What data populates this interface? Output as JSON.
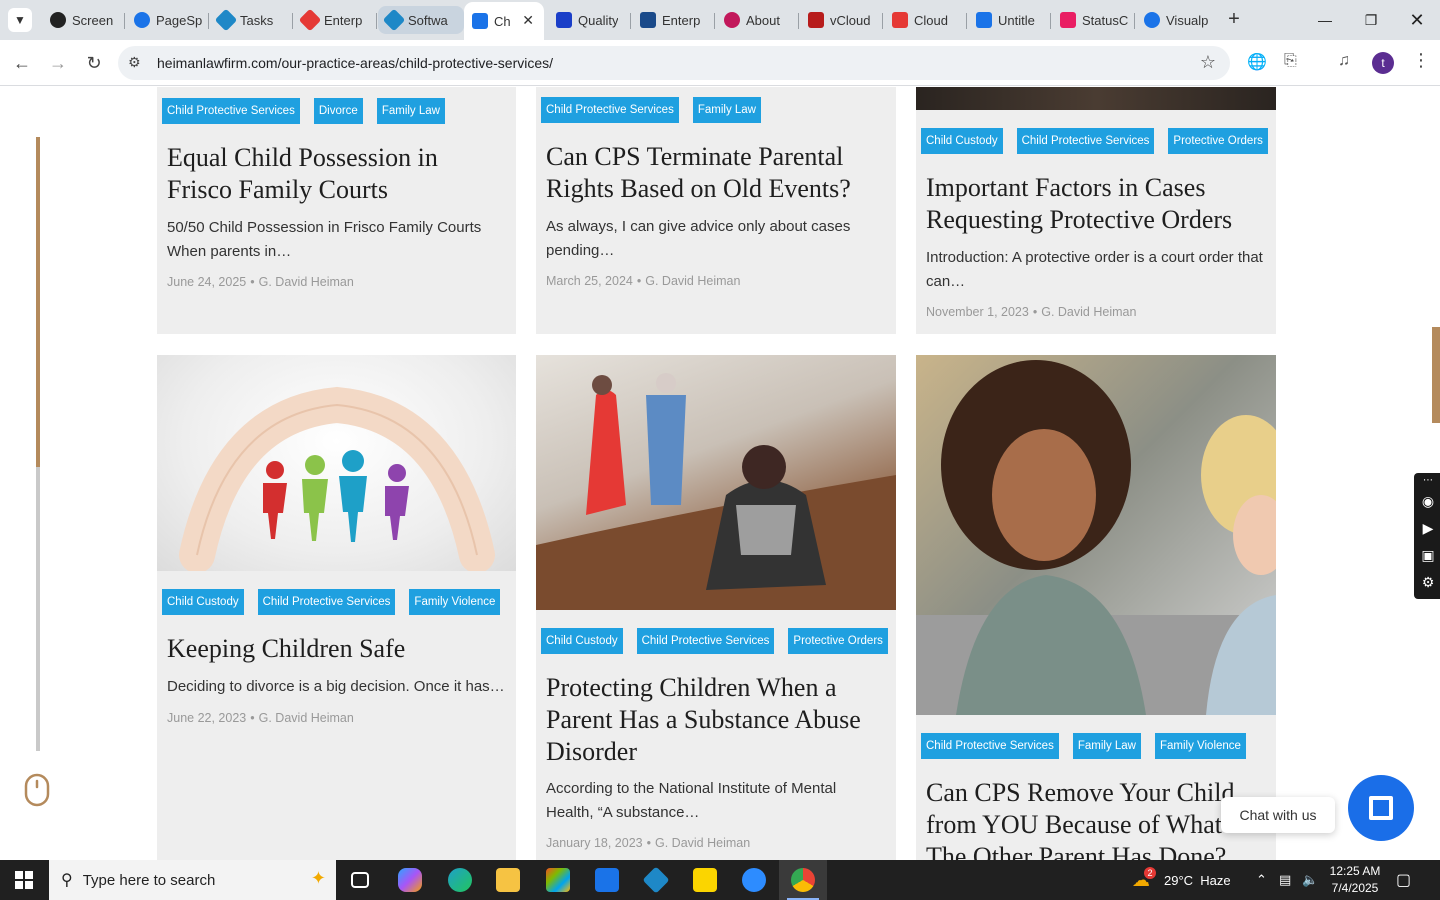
{
  "browser": {
    "tabs": [
      {
        "title": "Screen",
        "color": "#222222",
        "active": false
      },
      {
        "title": "PageSp",
        "color": "#1a73e8",
        "active": false
      },
      {
        "title": "Tasks",
        "color": "#1e88c7",
        "active": false
      },
      {
        "title": "Enterp",
        "color": "#e53935",
        "active": false
      },
      {
        "title": "Softwa",
        "color": "#1e88c7",
        "active": false
      },
      {
        "title": "Ch",
        "color": "#1a73e8",
        "active": true
      },
      {
        "title": "Quality",
        "color": "#1a3ec8",
        "active": false
      },
      {
        "title": "Enterp",
        "color": "#1a4a8a",
        "active": false
      },
      {
        "title": "About",
        "color": "#c2185b",
        "active": false
      },
      {
        "title": "vCloud",
        "color": "#b71c1c",
        "active": false
      },
      {
        "title": "Cloud",
        "color": "#e53935",
        "active": false
      },
      {
        "title": "Untitle",
        "color": "#1a73e8",
        "active": false
      },
      {
        "title": "StatusC",
        "color": "#e91e63",
        "active": false
      },
      {
        "title": "Visualp",
        "color": "#1a73e8",
        "active": false
      }
    ],
    "url": "heimanlawfirm.com/our-practice-areas/child-protective-services/",
    "profile_initial": "t"
  },
  "posts": [
    {
      "tags": [
        "Child Protective Services",
        "Divorce",
        "Family Law"
      ],
      "title": "Equal Child Possession in Frisco Family Courts",
      "excerpt": "50/50 Child Possession in Frisco Family Courts When parents in…",
      "date": "June 24, 2025",
      "author": "G. David Heiman"
    },
    {
      "tags": [
        "Child Protective Services",
        "Family Law"
      ],
      "title": "Can CPS Terminate Parental Rights Based on Old Events?",
      "excerpt": "As always, I can give advice only about cases pending…",
      "date": "March 25, 2024",
      "author": "G. David Heiman"
    },
    {
      "tags": [
        "Child Custody",
        "Child Protective Services",
        "Protective Orders"
      ],
      "title": "Important Factors in Cases Requesting Protective Orders",
      "excerpt": "Introduction: A protective order is a court order that can…",
      "date": "November 1, 2023",
      "author": "G. David Heiman"
    },
    {
      "tags": [
        "Child Custody",
        "Child Protective Services",
        "Family Violence"
      ],
      "title": "Keeping Children Safe",
      "excerpt": "Deciding to divorce is a big decision. Once it has…",
      "date": "June 22, 2023",
      "author": "G. David Heiman"
    },
    {
      "tags": [
        "Child Custody",
        "Child Protective Services",
        "Protective Orders"
      ],
      "title": "Protecting Children When a Parent Has a Substance Abuse Disorder",
      "excerpt": "According to the National Institute of Mental Health, “A substance…",
      "date": "January 18, 2023",
      "author": "G. David Heiman"
    },
    {
      "tags": [
        "Child Protective Services",
        "Family Law",
        "Family Violence"
      ],
      "title": "Can CPS Remove Your Child from YOU Because of What The Other Parent Has Done?",
      "excerpt": "",
      "date": "",
      "author": ""
    }
  ],
  "chat": {
    "label": "Chat with us"
  },
  "taskbar": {
    "search_placeholder": "Type here to search",
    "weather": "29°C  Haze",
    "time": "12:25 AM",
    "date": "7/4/2025",
    "weather_badge": "2"
  },
  "colors": {
    "tag_bg": "#1fa0e0",
    "accent": "#b48a5c",
    "chat": "#1a6ee8"
  }
}
